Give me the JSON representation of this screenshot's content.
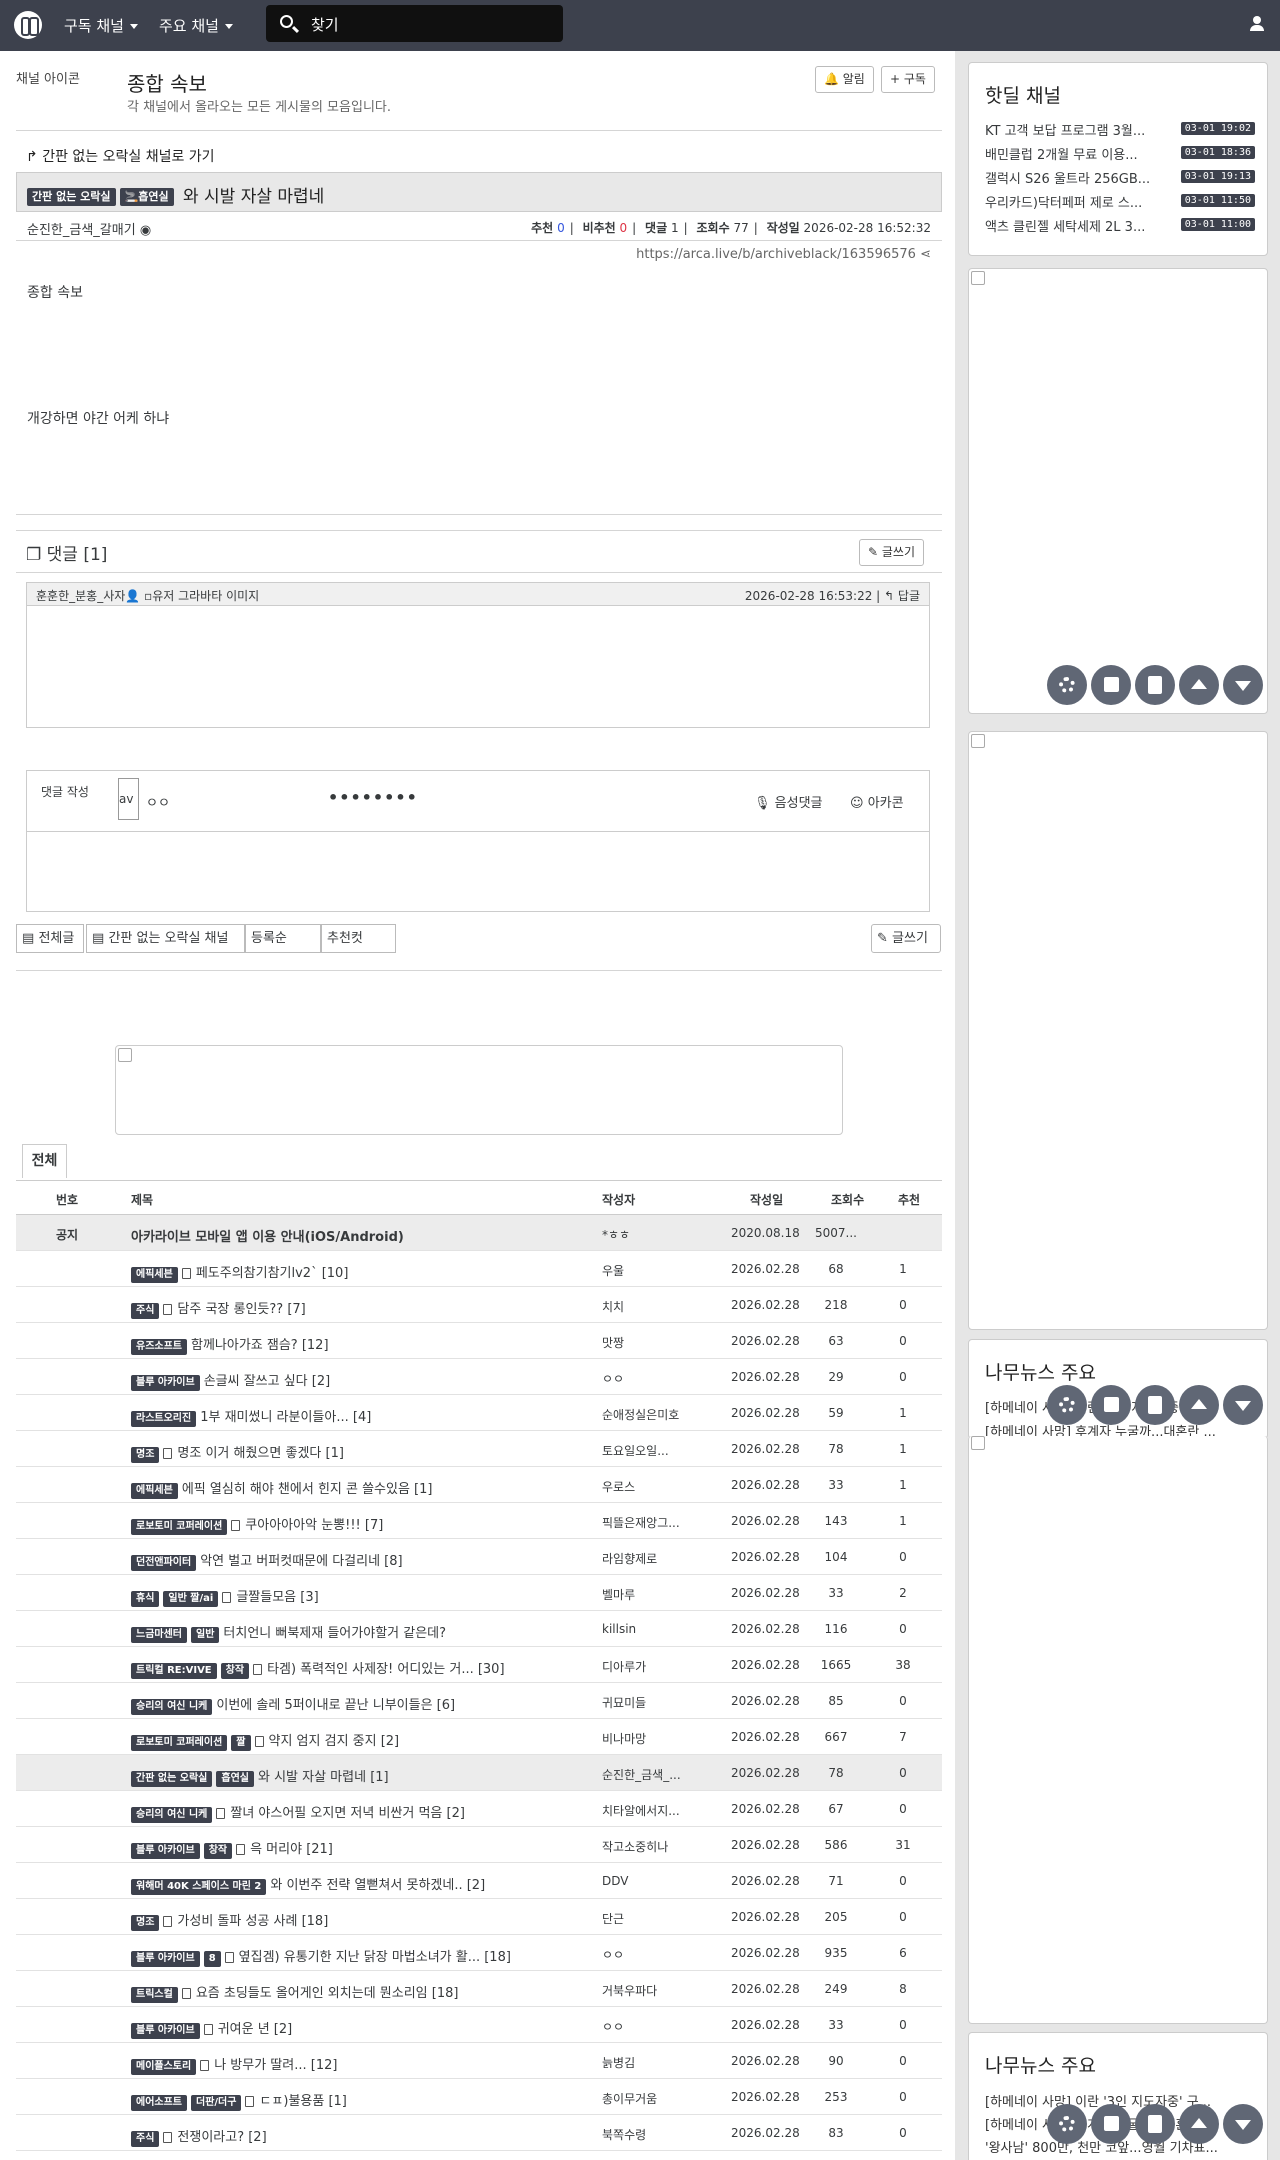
{
  "topbar": {
    "subscribed_channels": "구독 채널",
    "main_channels": "주요 채널",
    "search_placeholder": "찾기"
  },
  "channel": {
    "image_alt": "채널 아이콘",
    "title": "종합 속보",
    "description": "각 채널에서 올라오는 모든 게시물의 모음입니다.",
    "notify_label": "알림",
    "subscribe_label": "구독"
  },
  "article": {
    "back_link": "간판 없는 오락실 채널로 가기",
    "badges": [
      "간판 없는 오락실",
      "흡연실"
    ],
    "title": "와 시발 자살 마렵네",
    "author": "순진한_금색_갈매기",
    "recommend_label": "추천",
    "recommend": "0",
    "dislike_label": "비추천",
    "dislike": "0",
    "comments_label": "댓글",
    "comments": "1",
    "views_label": "조회수",
    "views": "77",
    "date_label": "작성일",
    "date": "2026-02-28 16:52:32",
    "url": "https://arca.live/b/archiveblack/163596576",
    "image_alt": "종합 속보",
    "body": "개강하면 야간 어케 하냐"
  },
  "comments": {
    "heading": "댓글 [1]",
    "write_button": "글쓰기",
    "items": [
      {
        "author": "훈훈한_분홍_사자",
        "avatar_alt": "유저 그라바타 이미지",
        "date": "2026-02-28 16:53:22",
        "reply": "답글"
      }
    ]
  },
  "comment_form": {
    "label": "댓글 작성",
    "avatar_alt": "av",
    "nickname": "ㅇㅇ",
    "password": "••••••••",
    "voice": "음성댓글",
    "arcacon": "아카콘"
  },
  "filters": {
    "all": "전체글",
    "channel": "간판 없는 오락실 채널",
    "order": "등록순",
    "best": "추천컷",
    "write": "글쓰기"
  },
  "tabs": {
    "all": "전체"
  },
  "table": {
    "headers": [
      "번호",
      "제목",
      "작성자",
      "작성일",
      "조회수",
      "추천"
    ],
    "notice": {
      "num": "공지",
      "title": "아카라이브 모바일 앱 이용 안내(iOS/Android)",
      "writer": "*ㅎㅎ",
      "date": "2020.08.18",
      "views": "5007...",
      "rec": ""
    },
    "rows": [
      {
        "cats": [
          "에픽세븐"
        ],
        "icon": true,
        "title": "페도주의참기참기lv2` [10]",
        "writer": "우울",
        "date": "2026.02.28",
        "views": "68",
        "rec": "1"
      },
      {
        "cats": [
          "주식"
        ],
        "icon": true,
        "title": "담주 국장 롱인듯?? [7]",
        "writer": "치치",
        "date": "2026.02.28",
        "views": "218",
        "rec": "0"
      },
      {
        "cats": [
          "유즈소프트"
        ],
        "icon": false,
        "title": "함께나아가죠 잼슴? [12]",
        "writer": "맛짱",
        "date": "2026.02.28",
        "views": "63",
        "rec": "0"
      },
      {
        "cats": [
          "블루 아카이브"
        ],
        "icon": false,
        "title": "손글씨 잘쓰고 싶다 [2]",
        "writer": "ㅇㅇ",
        "date": "2026.02.28",
        "views": "29",
        "rec": "0"
      },
      {
        "cats": [
          "라스트오리진"
        ],
        "icon": false,
        "title": "1부 재미썼니 라분이들아... [4]",
        "writer": "순애정실은미호",
        "date": "2026.02.28",
        "views": "59",
        "rec": "1"
      },
      {
        "cats": [
          "명조"
        ],
        "icon": true,
        "title": "명조 이거 해줬으면 좋겠다 [1]",
        "writer": "토요일오일...",
        "date": "2026.02.28",
        "views": "78",
        "rec": "1"
      },
      {
        "cats": [
          "에픽세븐"
        ],
        "icon": false,
        "title": "에픽 열심히 해야 챈에서 힌지 콘 쓸수있음 [1]",
        "writer": "우로스",
        "date": "2026.02.28",
        "views": "33",
        "rec": "1"
      },
      {
        "cats": [
          "로보토미 코퍼레이션"
        ],
        "icon": true,
        "title": "쿠아아아아악 눈뽕!!! [7]",
        "writer": "픽뜰은재앙그...",
        "date": "2026.02.28",
        "views": "143",
        "rec": "1"
      },
      {
        "cats": [
          "던전앤파이터"
        ],
        "icon": false,
        "title": "악연 벌고 버퍼컷때문에 다걸리네 [8]",
        "writer": "라임향제로",
        "date": "2026.02.28",
        "views": "104",
        "rec": "0"
      },
      {
        "cats": [
          "휴식",
          "일반 짤/ai"
        ],
        "icon": true,
        "title": "글짤들모음 [3]",
        "writer": "벨마루",
        "date": "2026.02.28",
        "views": "33",
        "rec": "2"
      },
      {
        "cats": [
          "느금마센터",
          "일반"
        ],
        "icon": false,
        "title": "터치언니 뻐북제재 들어가야할거 같은데?",
        "writer": "killsin",
        "date": "2026.02.28",
        "views": "116",
        "rec": "0"
      },
      {
        "cats": [
          "트릭컬 RE:VIVE",
          "창작"
        ],
        "icon": true,
        "title": "타겜) 폭력적인 사제장! 어디있는 거... [30]",
        "writer": "디아루가",
        "date": "2026.02.28",
        "views": "1665",
        "rec": "38"
      },
      {
        "cats": [
          "승리의 여신 니케"
        ],
        "icon": false,
        "title": "이번에 솔레 5퍼이내로 끝난 니부이들은 [6]",
        "writer": "귀묘미들",
        "date": "2026.02.28",
        "views": "85",
        "rec": "0"
      },
      {
        "cats": [
          "로보토미 코퍼레이션",
          "짤"
        ],
        "icon": true,
        "title": "약지 엄지 검지 중지 [2]",
        "writer": "비나마망",
        "date": "2026.02.28",
        "views": "667",
        "rec": "7"
      },
      {
        "cats": [
          "간판 없는 오락실",
          "흡연실"
        ],
        "icon": false,
        "title": "와 시발 자살 마렵네 [1]",
        "writer": "순진한_금색_...",
        "date": "2026.02.28",
        "views": "78",
        "rec": "0",
        "current": true
      },
      {
        "cats": [
          "승리의 여신 니케"
        ],
        "icon": true,
        "title": "짤녀 야스어필 오지면 저녁 비싼거 먹음 [2]",
        "writer": "치타알에서지...",
        "date": "2026.02.28",
        "views": "67",
        "rec": "0"
      },
      {
        "cats": [
          "블루 아카이브",
          "창작"
        ],
        "icon": true,
        "title": "윽 머리야 [21]",
        "writer": "작고소중히나",
        "date": "2026.02.28",
        "views": "586",
        "rec": "31"
      },
      {
        "cats": [
          "워해머 40K 스페이스 마린 2"
        ],
        "icon": false,
        "title": "와 이번주 전략 열뻗쳐서 못하겠네.. [2]",
        "writer": "DDV",
        "date": "2026.02.28",
        "views": "71",
        "rec": "0"
      },
      {
        "cats": [
          "명조"
        ],
        "icon": true,
        "title": "가성비 돌파 성공 사례 [18]",
        "writer": "단근",
        "date": "2026.02.28",
        "views": "205",
        "rec": "0"
      },
      {
        "cats": [
          "블루 아카이브",
          "8"
        ],
        "icon": true,
        "title": "옆집겜) 유통기한 지난 닭장 마법소녀가 활... [18]",
        "writer": "ㅇㅇ",
        "date": "2026.02.28",
        "views": "935",
        "rec": "6"
      },
      {
        "cats": [
          "트릭스컬"
        ],
        "icon": true,
        "title": "요즘 초딩들도 올어게인 외치는데 뭔소리임 [18]",
        "writer": "거북우파다",
        "date": "2026.02.28",
        "views": "249",
        "rec": "8"
      },
      {
        "cats": [
          "블루 아카이브"
        ],
        "icon": true,
        "title": "귀여운 년 [2]",
        "writer": "ㅇㅇ",
        "date": "2026.02.28",
        "views": "33",
        "rec": "0"
      },
      {
        "cats": [
          "메이플스토리"
        ],
        "icon": true,
        "title": "나 방무가 딸려... [12]",
        "writer": "늙병김",
        "date": "2026.02.28",
        "views": "90",
        "rec": "0"
      },
      {
        "cats": [
          "에어소프트",
          "더판/더구"
        ],
        "icon": true,
        "title": "ㄷㅍ)불용품 [1]",
        "writer": "총이무거움",
        "date": "2026.02.28",
        "views": "253",
        "rec": "0"
      },
      {
        "cats": [
          "주식"
        ],
        "icon": true,
        "title": "전쟁이라고? [2]",
        "writer": "북쪽수령",
        "date": "2026.02.28",
        "views": "83",
        "rec": "0"
      }
    ]
  },
  "sidebar": {
    "hotdeal_title": "핫딜 채널",
    "hotdeals": [
      {
        "title": "KT 고객 보답 프로그램 3월...",
        "time": "03-01 19:02"
      },
      {
        "title": "배민클럽 2개월 무료 이용...",
        "time": "03-01 18:36"
      },
      {
        "title": "갤럭시 S26 울트라 256GB...",
        "time": "03-01 19:13"
      },
      {
        "title": "우리카드)닥터페퍼 제로 스...",
        "time": "03-01 11:50"
      },
      {
        "title": "액츠 클린젤 세탁세제 2L 3...",
        "time": "03-01 11:00"
      }
    ],
    "news_title": "나무뉴스 주요",
    "news1": [
      "[하메네이 사망] 이란 '3인 지도자중' 구...",
      "[하메네이 사망] 후계자 누굴까...대혼란 ..."
    ],
    "news2": [
      "[하메네이 사망] 이란 '3인 지도자중' 구...",
      "[하메네이 사망] 후계자 누굴까...대혼란 ...",
      "'왕사남' 800만, 천만 코앞...영월 기차표..."
    ]
  }
}
